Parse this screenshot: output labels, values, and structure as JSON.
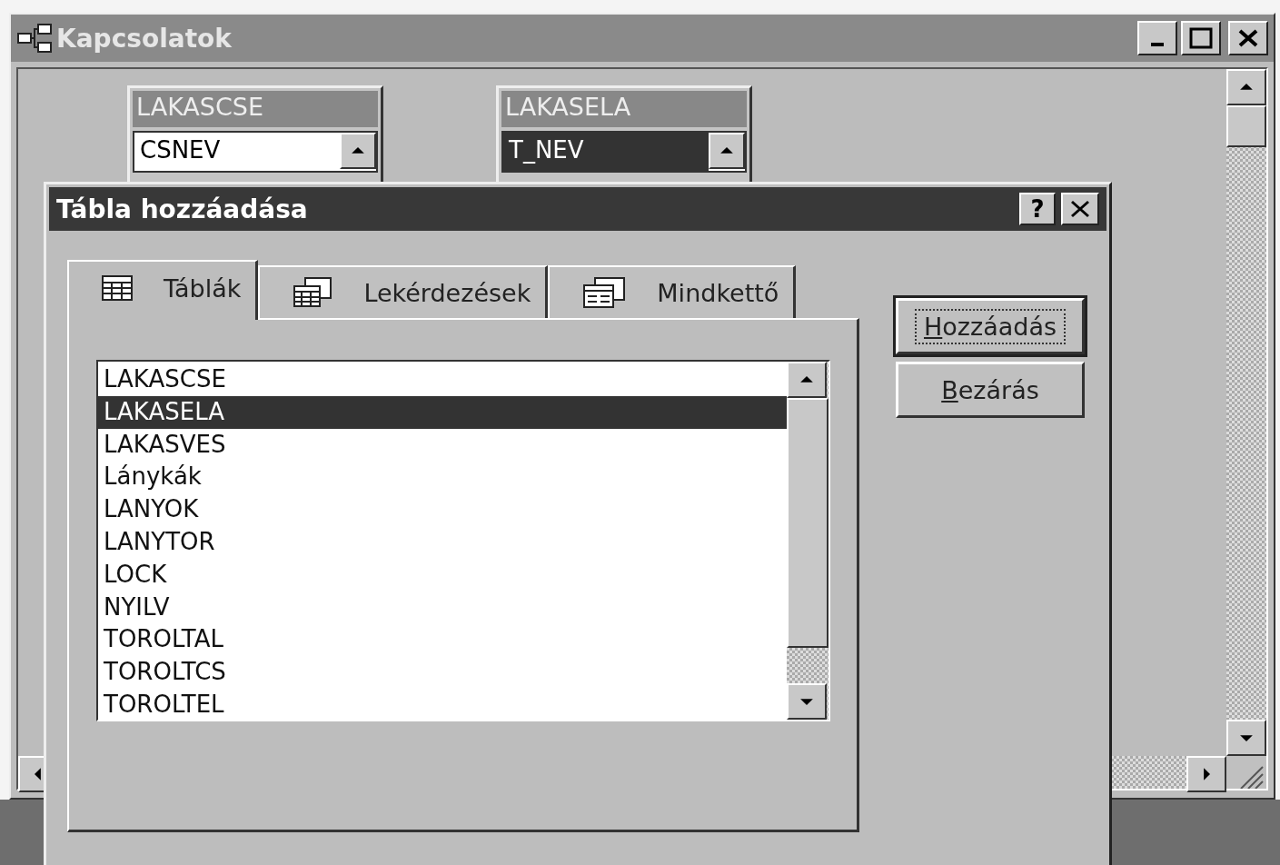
{
  "main_window": {
    "title": "Kapcsolatok"
  },
  "field_lists": [
    {
      "title": "LAKASCSE",
      "fields": [
        {
          "name": "CSNEV",
          "selected": false
        }
      ]
    },
    {
      "title": "LAKASELA",
      "fields": [
        {
          "name": "T_NEV",
          "selected": true
        }
      ]
    }
  ],
  "dialog": {
    "title": "Tábla hozzáadása",
    "help_button": "?",
    "tabs": [
      {
        "label": "Táblák",
        "kind": "tables",
        "selected": true
      },
      {
        "label": "Lekérdezések",
        "kind": "queries",
        "selected": false
      },
      {
        "label": "Mindkettő",
        "kind": "both",
        "selected": false
      }
    ],
    "list_items": [
      {
        "label": "LAKASCSE",
        "selected": false
      },
      {
        "label": "LAKASELA",
        "selected": true
      },
      {
        "label": "LAKASVES",
        "selected": false
      },
      {
        "label": "Lánykák",
        "selected": false
      },
      {
        "label": "LANYOK",
        "selected": false
      },
      {
        "label": "LANYTOR",
        "selected": false
      },
      {
        "label": "LOCK",
        "selected": false
      },
      {
        "label": "NYILV",
        "selected": false
      },
      {
        "label": "TOROLTAL",
        "selected": false
      },
      {
        "label": "TOROLTCS",
        "selected": false
      },
      {
        "label": "TOROLTEL",
        "selected": false
      }
    ],
    "buttons": [
      {
        "label": "Hozzáadás",
        "focused": true
      },
      {
        "label": "Bezárás",
        "focused": false
      }
    ]
  }
}
